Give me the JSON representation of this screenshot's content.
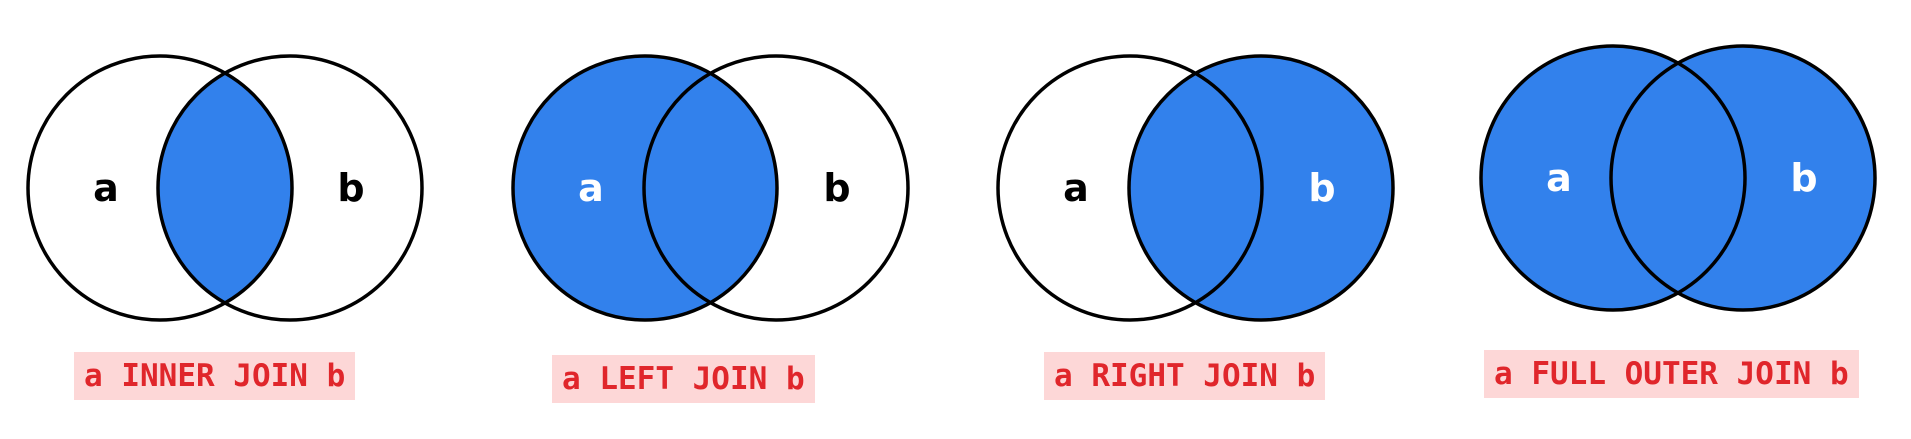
{
  "colors": {
    "fill": "#3281ec",
    "stroke": "#000000",
    "label_dark": "#000000",
    "label_light": "#ffffff",
    "caption_text": "#e0262b",
    "caption_bg": "#fdd7d7"
  },
  "diagrams": [
    {
      "caption": "a INNER JOIN b",
      "left_label": "a",
      "right_label": "b",
      "shaded_region": "intersection"
    },
    {
      "caption": "a LEFT JOIN b",
      "left_label": "a",
      "right_label": "b",
      "shaded_region": "left"
    },
    {
      "caption": "a RIGHT JOIN b",
      "left_label": "a",
      "right_label": "b",
      "shaded_region": "right"
    },
    {
      "caption": "a FULL OUTER JOIN b",
      "left_label": "a",
      "right_label": "b",
      "shaded_region": "both"
    }
  ]
}
